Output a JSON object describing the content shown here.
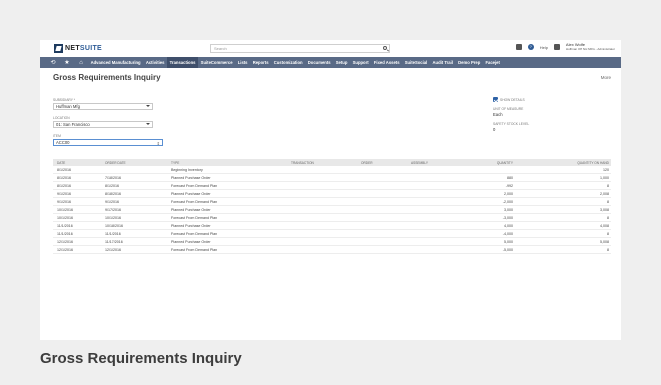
{
  "app": {
    "brand_a": "NET",
    "brand_b": "SUITE"
  },
  "header": {
    "search_placeholder": "Search",
    "help_label": "Help",
    "user_name": "Alex Wolfe",
    "user_role": "Huffman Off Ntc MFG - Administrator"
  },
  "nav": {
    "items": [
      "Advanced Manufacturing",
      "Activities",
      "Transactions",
      "SuiteCommerce",
      "Lists",
      "Reports",
      "Customization",
      "Documents",
      "Setup",
      "Support",
      "Fixed Assets",
      "SuiteSocial",
      "Audit Trail",
      "Demo Prep",
      "Facejet"
    ],
    "active": "Transactions"
  },
  "page": {
    "title": "Gross Requirements Inquiry",
    "more": "More"
  },
  "form": {
    "subsidiary_label": "Subsidiary *",
    "subsidiary_value": "Huffman Mfg",
    "location_label": "Location",
    "location_value": "01: San Francisco",
    "item_label": "Item",
    "item_value": "ACC00",
    "show_details_label": "Show Details",
    "uom_label": "Unit of Measure",
    "uom_value": "Each",
    "safety_label": "Safety Stock Level",
    "safety_value": "0"
  },
  "table": {
    "headers": [
      "Date",
      "Order Date",
      "Type",
      "Transaction",
      "Order",
      "Assembly",
      "Quantity",
      "Quantity on Hand"
    ],
    "rows": [
      [
        "8/1/2016",
        "",
        "Beginning Inventory",
        "",
        "",
        "",
        "",
        "120"
      ],
      [
        "8/1/2016",
        "7/18/2016",
        "Planned Purchase Order",
        "",
        "",
        "",
        "880",
        "1,000"
      ],
      [
        "8/1/2016",
        "8/1/2016",
        "Forecast From Demand Plan",
        "",
        "",
        "",
        "-992",
        "8"
      ],
      [
        "9/1/2016",
        "8/18/2016",
        "Planned Purchase Order",
        "",
        "",
        "",
        "2,000",
        "2,008"
      ],
      [
        "9/1/2016",
        "9/1/2016",
        "Forecast From Demand Plan",
        "",
        "",
        "",
        "-2,000",
        "8"
      ],
      [
        "10/1/2016",
        "9/17/2016",
        "Planned Purchase Order",
        "",
        "",
        "",
        "3,000",
        "3,008"
      ],
      [
        "10/1/2016",
        "10/1/2016",
        "Forecast From Demand Plan",
        "",
        "",
        "",
        "-3,000",
        "8"
      ],
      [
        "11/1/2016",
        "10/18/2016",
        "Planned Purchase Order",
        "",
        "",
        "",
        "4,000",
        "4,008"
      ],
      [
        "11/1/2016",
        "11/1/2016",
        "Forecast From Demand Plan",
        "",
        "",
        "",
        "-4,000",
        "8"
      ],
      [
        "12/1/2016",
        "11/17/2016",
        "Planned Purchase Order",
        "",
        "",
        "",
        "5,000",
        "5,008"
      ],
      [
        "12/1/2016",
        "12/1/2016",
        "Forecast From Demand Plan",
        "",
        "",
        "",
        "-5,000",
        "8"
      ]
    ]
  },
  "caption": "Gross Requirements Inquiry",
  "colors": {
    "nav": "#596a86",
    "accent": "#2e62a6"
  }
}
